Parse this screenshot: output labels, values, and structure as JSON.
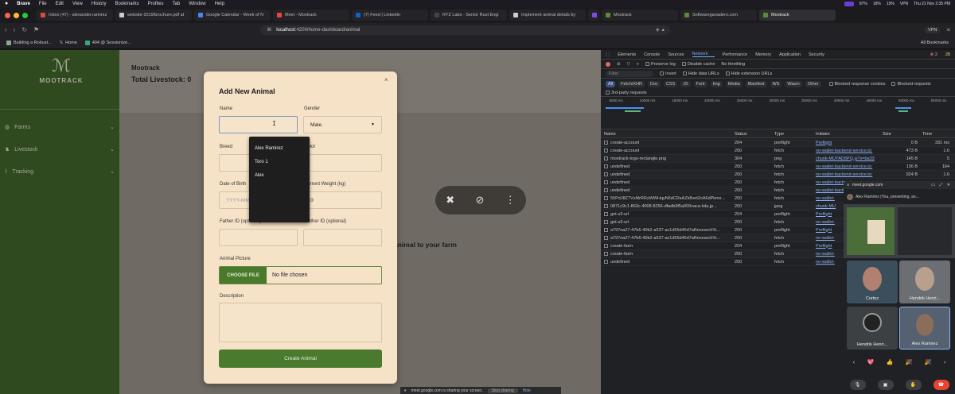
{
  "macos_menubar": {
    "app": "Brave",
    "menus": [
      "File",
      "Edit",
      "View",
      "History",
      "Bookmarks",
      "Profiles",
      "Tab",
      "Window",
      "Help"
    ],
    "status": [
      "87%",
      "18%",
      "15%",
      "VPN",
      "Thu 21 Nov 2:35 PM"
    ]
  },
  "browser": {
    "tabs": [
      {
        "label": "Inbox (47) - alexander.ramirez",
        "color": "#d64d3c"
      },
      {
        "label": "website-2019/brochure.pdf at",
        "color": "#cccccc"
      },
      {
        "label": "Google Calendar - Week of N",
        "color": "#4a86e8"
      },
      {
        "label": "Meet - Mootrack",
        "color": "#e8453c"
      },
      {
        "label": "(7) Feed | LinkedIn",
        "color": "#0a66c2"
      },
      {
        "label": "RYZ Labs - Senior Rust Engi",
        "color": "#444444"
      },
      {
        "label": "Implement animal details by",
        "color": "#cccccc"
      },
      {
        "label": "",
        "color": "#7c4ddf"
      },
      {
        "label": "Mootrack",
        "color": "#5b8a3a"
      },
      {
        "label": "Softwareganadero.com",
        "color": "#5b8a3a"
      },
      {
        "label": "Mootrack",
        "color": "#5b8a3a",
        "active": true
      }
    ],
    "url_host": "localhost",
    "url_path": ":4200/home-dashboard/animal",
    "vpn_label": "VPN",
    "bookmarks": [
      "Building a Robust...",
      "Home",
      "404 @ Sessionize..."
    ],
    "all_bookmarks": "All Bookmarks"
  },
  "app": {
    "logo_text": "MOOTRACK",
    "sidebar": [
      {
        "label": "Farms"
      },
      {
        "label": "Livestock"
      },
      {
        "label": "Tracking"
      }
    ],
    "header_title": "Mootrack",
    "total_livestock": "Total Livestock: 0",
    "background_text": "animal to your farm",
    "share_notice": "meet.google.com is sharing your screen.",
    "stop_sharing": "Stop sharing",
    "hide": "Hide"
  },
  "modal": {
    "title": "Add New Animal",
    "close": "×",
    "fields": {
      "name_label": "Name",
      "gender_label": "Gender",
      "gender_value": "Male",
      "breed_label": "Breed",
      "color_label": "Color",
      "dob_label": "Date of Birth",
      "dob_placeholder": "YYYY-MM-DD",
      "weight_label": "Current Weight (kg)",
      "weight_value": "0",
      "father_label": "Father ID (optional)",
      "mother_label": "Mother ID (optional)",
      "picture_label": "Animal Picture",
      "choose_file": "CHOOSE FILE",
      "no_file": "No file chosen",
      "description_label": "Description"
    },
    "submit": "Create Animal"
  },
  "autocomplete": [
    "Alex Ramirez",
    "Toro 1",
    "Alex"
  ],
  "devtools": {
    "tabs": [
      "Elements",
      "Console",
      "Sources",
      "Network",
      "Performance",
      "Memory",
      "Application",
      "Security"
    ],
    "selected_tab": "Network",
    "errors": "⊗ 3",
    "warnings": "28",
    "toolbar": [
      "Preserve log",
      "Disable cache",
      "No throttling"
    ],
    "filter_placeholder": "Filter",
    "filter_opts": [
      "Invert",
      "Hide data URLs",
      "Hide extension URLs"
    ],
    "chips": [
      "All",
      "Fetch/XHR",
      "Doc",
      "CSS",
      "JS",
      "Font",
      "Img",
      "Media",
      "Manifest",
      "WS",
      "Wasm",
      "Other"
    ],
    "blocked": [
      "Blocked response cookies",
      "Blocked requests"
    ],
    "third_party": "3rd-party requests",
    "ticks": [
      "5000 ms",
      "10000 ms",
      "15000 ms",
      "20000 ms",
      "25000 ms",
      "30000 ms",
      "35000 ms",
      "40000 ms",
      "45000 ms",
      "50000 ms",
      "55000 ms"
    ],
    "columns": [
      "Name",
      "Status",
      "Type",
      "Initiator",
      "Size",
      "Time"
    ],
    "rows": [
      {
        "name": "create-account",
        "status": "204",
        "type": "preflight",
        "initiator": "Preflight",
        "size": "0 B",
        "time": "331 ms"
      },
      {
        "name": "create-account",
        "status": "200",
        "type": "fetch",
        "initiator": "no-wallet-backend-service.ts:",
        "size": "473 B",
        "time": "1.6"
      },
      {
        "name": "mootrack-logo-rectangle.png",
        "status": "304",
        "type": "png",
        "initiator": "chunk-MUYAD6PQ.js?v=ba33",
        "size": "145 B",
        "time": "5"
      },
      {
        "name": "undefined",
        "status": "200",
        "type": "fetch",
        "initiator": "no-wallet-backend-service.ts:",
        "size": "136 B",
        "time": "164"
      },
      {
        "name": "undefined",
        "status": "200",
        "type": "fetch",
        "initiator": "no-wallet-backend-service.ts:",
        "size": "924 B",
        "time": "1.6"
      },
      {
        "name": "undefined",
        "status": "200",
        "type": "fetch",
        "initiator": "no-wallet-backend-service.ts:",
        "size": "",
        "time": ""
      },
      {
        "name": "undefined",
        "status": "200",
        "type": "fetch",
        "initiator": "no-wallet-backend-service.ts:",
        "size": "",
        "time": ""
      },
      {
        "name": "55PdJ8Z7VsMrRRzWWHqyN6dCRsAZk8vet2oA6dPkmx...",
        "status": "200",
        "type": "fetch",
        "initiator": "no-wallet-",
        "size": "",
        "time": ""
      },
      {
        "name": "0871c9c1-863c-4008-8256-dfadb9f5a009vaca-lola.jp...",
        "status": "200",
        "type": "jpeg",
        "initiator": "chunk-MU",
        "size": "",
        "time": ""
      },
      {
        "name": "get-s3-url",
        "status": "204",
        "type": "preflight",
        "initiator": "Preflight",
        "size": "",
        "time": ""
      },
      {
        "name": "get-s3-url",
        "status": "200",
        "type": "fetch",
        "initiator": "no-wallet-",
        "size": "",
        "time": ""
      },
      {
        "name": "a797ea27-47b6-40b2-a537-ac1d55d45d7aResearch%...",
        "status": "200",
        "type": "preflight",
        "initiator": "Preflight",
        "size": "",
        "time": ""
      },
      {
        "name": "a797ea27-47b6-40b2-a537-ac1d55d45d7aResearch%...",
        "status": "200",
        "type": "fetch",
        "initiator": "no-wallet-",
        "size": "",
        "time": ""
      },
      {
        "name": "create-farm",
        "status": "204",
        "type": "preflight",
        "initiator": "Preflight",
        "size": "",
        "time": ""
      },
      {
        "name": "create-farm",
        "status": "200",
        "type": "fetch",
        "initiator": "no-wallet-",
        "size": "",
        "time": ""
      },
      {
        "name": "undefined",
        "status": "200",
        "type": "fetch",
        "initiator": "no-wallet-",
        "size": "",
        "time": ""
      }
    ]
  },
  "meet": {
    "host": "meet.google.com",
    "presenter": "Alex Ramirez (You, presenting, an...",
    "participants": [
      {
        "name": "Cortez"
      },
      {
        "name": "Hendrik Henri..."
      },
      {
        "name": "Hendrik Henri..."
      },
      {
        "name": "Alex Ramirez"
      }
    ],
    "reactions": [
      "‹",
      "💖",
      "👍",
      "🎉",
      "🎉",
      "›"
    ]
  }
}
